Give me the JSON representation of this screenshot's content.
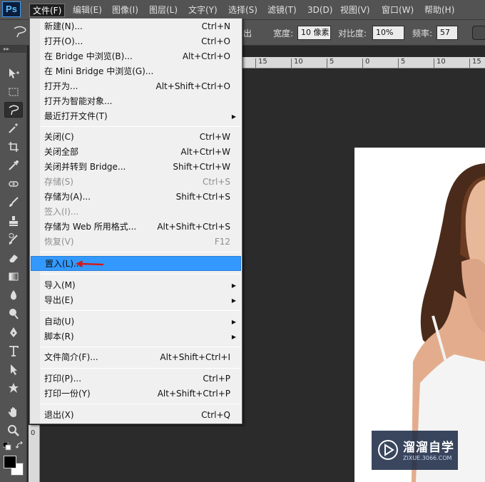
{
  "app": {
    "logo": "Ps",
    "menubar": [
      "文件(F)",
      "编辑(E)",
      "图像(I)",
      "图层(L)",
      "文字(Y)",
      "选择(S)",
      "滤镜(T)",
      "3D(D)",
      "视图(V)",
      "窗口(W)",
      "帮助(H)"
    ]
  },
  "options_bar": {
    "partial_label": "出",
    "width_label": "宽度:",
    "width_value": "10 像素",
    "contrast_label": "对比度:",
    "contrast_value": "10%",
    "frequency_label": "频率:",
    "frequency_value": "57"
  },
  "file_menu": {
    "items": [
      {
        "label": "新建(N)...",
        "shortcut": "Ctrl+N"
      },
      {
        "label": "打开(O)...",
        "shortcut": "Ctrl+O"
      },
      {
        "label": "在 Bridge 中浏览(B)...",
        "shortcut": "Alt+Ctrl+O"
      },
      {
        "label": "在 Mini Bridge 中浏览(G)...",
        "shortcut": ""
      },
      {
        "label": "打开为...",
        "shortcut": "Alt+Shift+Ctrl+O"
      },
      {
        "label": "打开为智能对象...",
        "shortcut": ""
      },
      {
        "label": "最近打开文件(T)",
        "shortcut": ""
      },
      {
        "label": "关闭(C)",
        "shortcut": "Ctrl+W"
      },
      {
        "label": "关闭全部",
        "shortcut": "Alt+Ctrl+W"
      },
      {
        "label": "关闭并转到 Bridge...",
        "shortcut": "Shift+Ctrl+W"
      },
      {
        "label": "存储(S)",
        "shortcut": "Ctrl+S"
      },
      {
        "label": "存储为(A)...",
        "shortcut": "Shift+Ctrl+S"
      },
      {
        "label": "签入(I)...",
        "shortcut": ""
      },
      {
        "label": "存储为 Web 所用格式...",
        "shortcut": "Alt+Shift+Ctrl+S"
      },
      {
        "label": "恢复(V)",
        "shortcut": "F12"
      },
      {
        "label": "置入(L)...",
        "shortcut": ""
      },
      {
        "label": "导入(M)",
        "shortcut": ""
      },
      {
        "label": "导出(E)",
        "shortcut": ""
      },
      {
        "label": "自动(U)",
        "shortcut": ""
      },
      {
        "label": "脚本(R)",
        "shortcut": ""
      },
      {
        "label": "文件简介(F)...",
        "shortcut": "Alt+Shift+Ctrl+I"
      },
      {
        "label": "打印(P)...",
        "shortcut": "Ctrl+P"
      },
      {
        "label": "打印一份(Y)",
        "shortcut": "Alt+Shift+Ctrl+P"
      },
      {
        "label": "退出(X)",
        "shortcut": "Ctrl+Q"
      }
    ],
    "highlight_color": "#3399ff",
    "disabled_color": "#8e8e8e"
  },
  "document": {
    "ruler_top": [
      "15",
      "10",
      "5",
      "0",
      "5",
      "10",
      "15"
    ],
    "ruler_left": "0"
  },
  "watermark": {
    "title": "溜溜自学",
    "subtitle": "ZIXUE.3066.COM"
  },
  "tools": [
    "move-tool-icon",
    "marquee-tool-icon",
    "lasso-tool-icon",
    "magic-wand-icon",
    "crop-tool-icon",
    "eyedropper-icon",
    "healing-brush-icon",
    "brush-tool-icon",
    "clone-stamp-icon",
    "history-brush-icon",
    "eraser-icon",
    "gradient-icon",
    "blur-tool-icon",
    "dodge-tool-icon",
    "pen-tool-icon",
    "type-tool-icon",
    "path-selection-icon",
    "custom-shape-icon",
    "hand-tool-icon",
    "zoom-tool-icon"
  ],
  "colors": {
    "ui_gray": "#535353",
    "canvas_bg": "#2b2b2b",
    "menu_bg": "#f0f0f0",
    "accent_arrow": "#d11a1a"
  }
}
